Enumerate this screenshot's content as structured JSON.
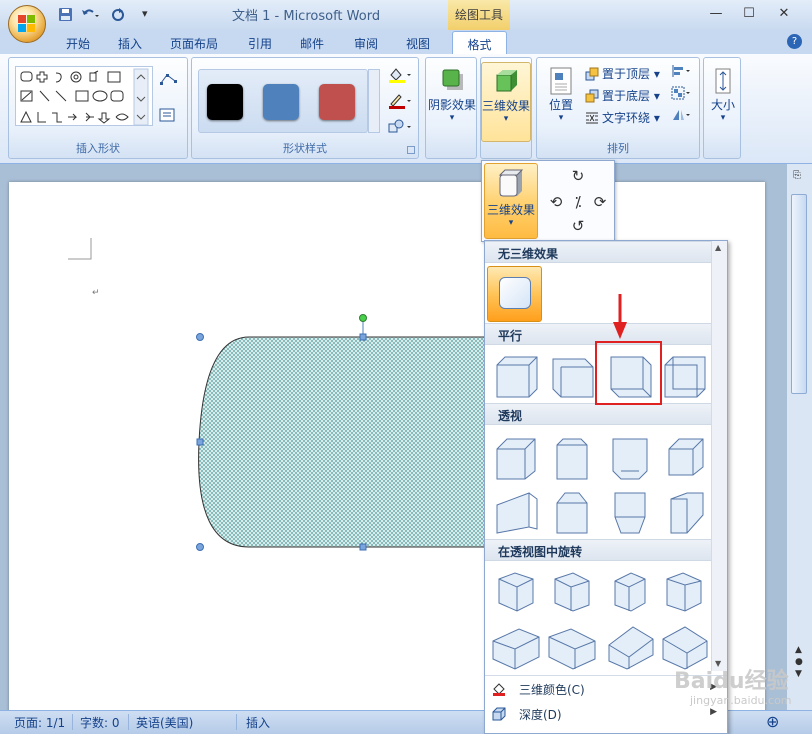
{
  "title": "文档 1 - Microsoft Word",
  "context_tab_group": "绘图工具",
  "tabs": [
    "开始",
    "插入",
    "页面布局",
    "引用",
    "邮件",
    "审阅",
    "视图"
  ],
  "active_tab": "格式",
  "ribbon": {
    "insert_shapes_label": "插入形状",
    "shape_styles_label": "形状样式",
    "shadow_effects": "阴影效果",
    "three_d_effects": "三维效果",
    "position": "位置",
    "bring_to_front": "置于顶层",
    "send_to_back": "置于底层",
    "text_wrapping": "文字环绕",
    "arrange_label": "排列",
    "size": "大小",
    "swatch_colors": [
      "#000000",
      "#4f81bd",
      "#c0504d"
    ]
  },
  "dropdown": {
    "button_label": "三维效果",
    "sections": {
      "none": "无三维效果",
      "parallel": "平行",
      "perspective": "透视",
      "rotation": "在透视图中旋转"
    },
    "menu": [
      {
        "label": "三维颜色(C)"
      },
      {
        "label": "深度(D)"
      }
    ]
  },
  "status": {
    "page": "页面: 1/1",
    "words": "字数: 0",
    "language": "英语(美国)",
    "mode": "插入"
  },
  "colors": {
    "shape_fill": "#d9ebea",
    "shape_dots": "#4a9a9a",
    "highlight": "#e02121",
    "accent_orange": "#ffc458"
  },
  "watermark": {
    "brand": "Baidu经验",
    "url": "jingyan.baidu.com"
  }
}
